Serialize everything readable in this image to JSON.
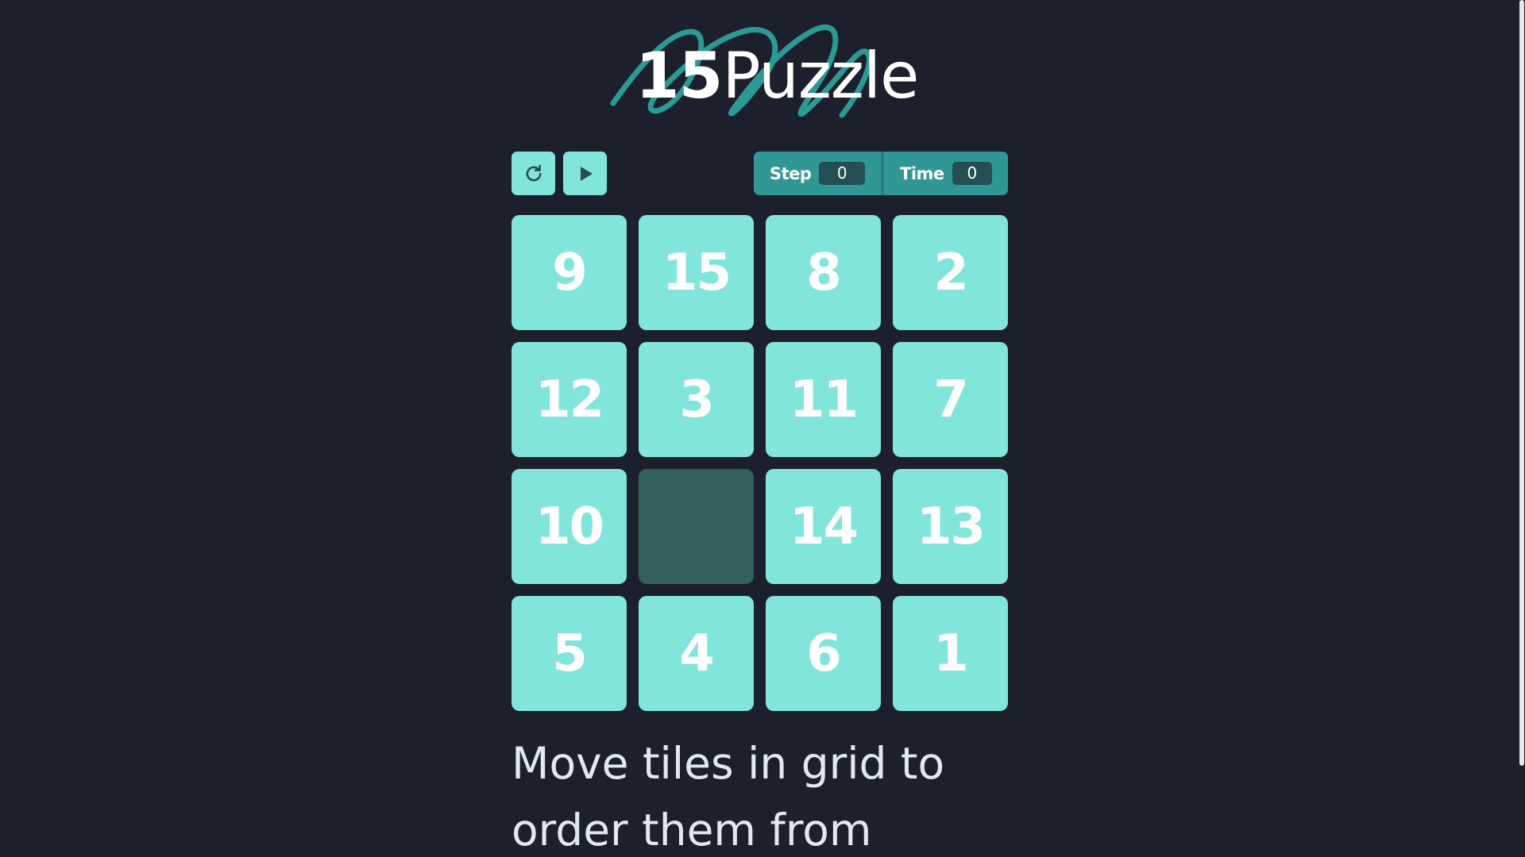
{
  "title": {
    "number": "15",
    "word": "Puzzle"
  },
  "controls": {
    "restart_icon": "restart-icon",
    "play_icon": "play-icon",
    "step_label": "Step",
    "step_value": "0",
    "time_label": "Time",
    "time_value": "0"
  },
  "board": {
    "tiles": [
      "9",
      "15",
      "8",
      "2",
      "12",
      "3",
      "11",
      "7",
      "10",
      "",
      "14",
      "13",
      "5",
      "4",
      "6",
      "1"
    ]
  },
  "instructions": "Move tiles in grid to order them from",
  "colors": {
    "background": "#1b202c",
    "tile": "#81e6d9",
    "tile_empty": "#335f5c",
    "accent": "#319795",
    "stat_value_bg": "#234e52",
    "text": "#ffffff"
  }
}
